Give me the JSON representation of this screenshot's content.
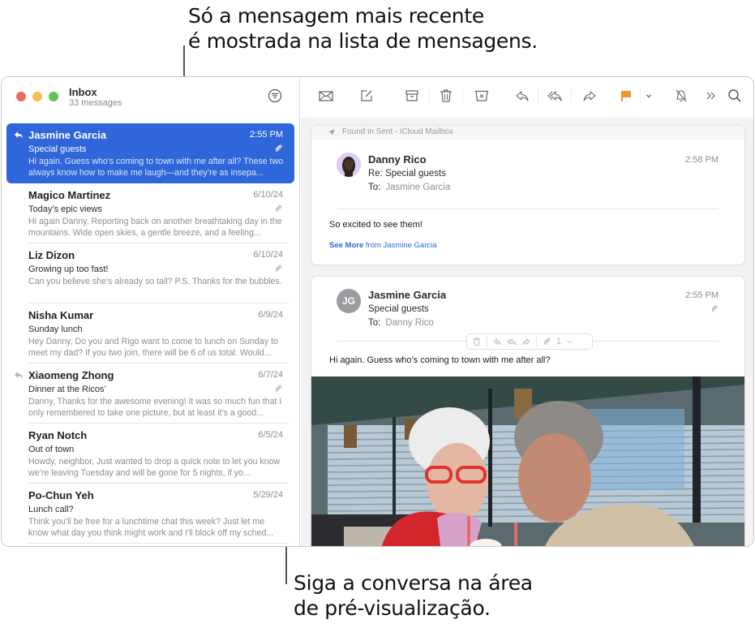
{
  "callouts": {
    "top_line1": "Só a mensagem mais recente",
    "top_line2": "é mostrada na lista de mensagens.",
    "bottom_line1": "Siga a conversa na área",
    "bottom_line2": "de pré-visualização."
  },
  "sidebar": {
    "mailbox_title": "Inbox",
    "message_count": "33 messages",
    "filter_icon": "filter-circle-icon"
  },
  "toolbar": {
    "items": [
      {
        "name": "get-mail",
        "icon": "envelope-icon"
      },
      {
        "name": "compose",
        "icon": "compose-icon"
      },
      {
        "name": "archive",
        "icon": "archive-box-icon"
      },
      {
        "name": "delete",
        "icon": "trash-icon"
      },
      {
        "name": "junk",
        "icon": "junk-box-icon"
      },
      {
        "name": "reply",
        "icon": "reply-icon"
      },
      {
        "name": "reply-all",
        "icon": "reply-all-icon"
      },
      {
        "name": "forward",
        "icon": "forward-icon"
      },
      {
        "name": "flag",
        "icon": "flag-icon",
        "color": "#f0962c"
      },
      {
        "name": "flag-menu",
        "icon": "chevron-down-icon"
      },
      {
        "name": "mute",
        "icon": "bell-slash-icon"
      },
      {
        "name": "more",
        "icon": "double-chevron-right-icon"
      },
      {
        "name": "search",
        "icon": "search-icon"
      }
    ]
  },
  "messages": [
    {
      "sender": "Jasmine Garcia",
      "date": "2:55 PM",
      "subject": "Special guests",
      "preview": "Hi again. Guess who’s coming to town with me after all? These two always know how to make me laugh—and they’re as insepa...",
      "attachment": true,
      "replied": true,
      "selected": true
    },
    {
      "sender": "Magico Martinez",
      "date": "6/10/24",
      "subject": "Today’s epic views",
      "preview": "Hi again Danny, Reporting back on another breathtaking day in the mountains. Wide open skies, a gentle breeze, and a feeling...",
      "attachment": true,
      "replied": false,
      "selected": false
    },
    {
      "sender": "Liz Dizon",
      "date": "6/10/24",
      "subject": "Growing up too fast!",
      "preview": "Can you believe she's already so tall? P.S. Thanks for the bubbles.",
      "attachment": true,
      "replied": false,
      "selected": false
    },
    {
      "sender": "Nisha Kumar",
      "date": "6/9/24",
      "subject": "Sunday lunch",
      "preview": "Hey Danny, Do you and Rigo want to come to lunch on Sunday to meet my dad? If you two join, there will be 6 of us total. Would...",
      "attachment": false,
      "replied": false,
      "selected": false
    },
    {
      "sender": "Xiaomeng Zhong",
      "date": "6/7/24",
      "subject": "Dinner at the Ricos’",
      "preview": "Danny, Thanks for the awesome evening! It was so much fun that I only remembered to take one picture, but at least it’s a good...",
      "attachment": true,
      "replied": true,
      "selected": false
    },
    {
      "sender": "Ryan Notch",
      "date": "6/5/24",
      "subject": "Out of town",
      "preview": "Howdy, neighbor, Just wanted to drop a quick note to let you know we’re leaving Tuesday and will be gone for 5 nights, if yo...",
      "attachment": false,
      "replied": false,
      "selected": false
    },
    {
      "sender": "Po-Chun Yeh",
      "date": "5/29/24",
      "subject": "Lunch call?",
      "preview": "Think you'll be free for a lunchtime chat this week? Just let me know what day you think might work and I'll block off my sched...",
      "attachment": false,
      "replied": false,
      "selected": false
    }
  ],
  "thread": {
    "reply": {
      "found_in": "Found in Sent - iCloud Mailbox",
      "sender": "Danny Rico",
      "subject": "Re: Special guests",
      "to_label": "To:",
      "to": "Jasmine Garcia",
      "time": "2:58 PM",
      "body": "So excited to see them!",
      "see_more_bold": "See More",
      "see_more_rest": " from Jasmine Garcia"
    },
    "original": {
      "sender": "Jasmine Garcia",
      "initials": "JG",
      "subject": "Special guests",
      "to_label": "To:",
      "to": "Danny Rico",
      "time": "2:55 PM",
      "body": "Hi again. Guess who’s coming to town with me after all?",
      "attachment_count": "1",
      "photo_description": "Older woman with white hair and red glasses and a man with grey hair sharing a milkshake with striped straws in a diner"
    }
  },
  "colors": {
    "accent": "#2f66d9",
    "flag": "#f0962c"
  }
}
